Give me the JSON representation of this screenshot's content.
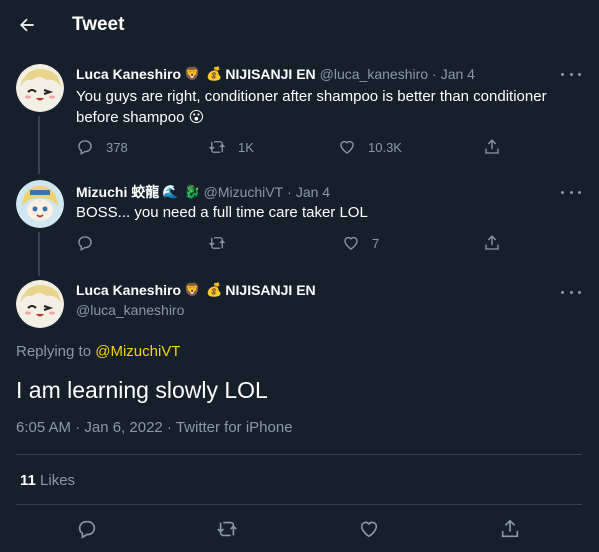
{
  "header": {
    "title": "Tweet"
  },
  "thread": [
    {
      "display_name": "Luca Kaneshiro",
      "name_emojis": [
        "🦁",
        "💰"
      ],
      "org": "NIJISANJI EN",
      "handle": "@luca_kaneshiro",
      "date": "Jan 4",
      "text": "You guys are right, conditioner after shampoo is better than conditioner before shampoo",
      "text_emoji": "😮",
      "replies": "378",
      "retweets": "1K",
      "likes": "10.3K"
    },
    {
      "display_name": "Mizuchi 蛟龍",
      "name_emojis": [
        "🌊",
        "🐉"
      ],
      "handle": "@MizuchiVT",
      "date": "Jan 4",
      "text": "BOSS... you need a full time care taker LOL",
      "replies": "",
      "retweets": "",
      "likes": "7"
    }
  ],
  "main_tweet": {
    "display_name": "Luca Kaneshiro",
    "name_emojis": [
      "🦁",
      "💰"
    ],
    "org": "NIJISANJI EN",
    "handle": "@luca_kaneshiro",
    "replying_label": "Replying to",
    "replying_to": "@MizuchiVT",
    "text": "I am learning slowly LOL",
    "timestamp": "6:05 AM · Jan 6, 2022 · Twitter for iPhone",
    "likes_count": "11",
    "likes_label": "Likes"
  },
  "colors": {
    "background": "#15202b",
    "muted": "#8b98a5",
    "divider": "#38444d",
    "mention": "#f5d400"
  },
  "icons": [
    "back-arrow-icon",
    "more-icon",
    "reply-icon",
    "retweet-icon",
    "like-icon",
    "share-icon"
  ]
}
